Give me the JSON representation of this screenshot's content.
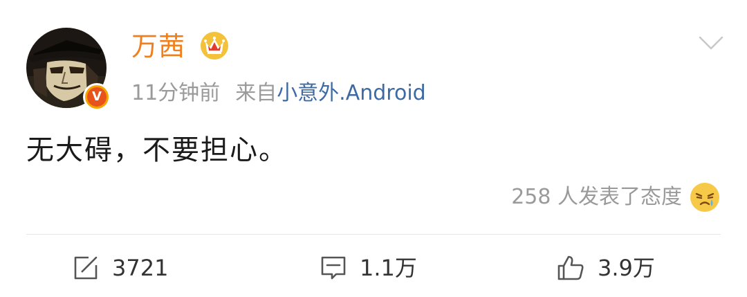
{
  "post": {
    "username": "万茜",
    "time": "11分钟前",
    "source_prefix": "来自",
    "source_name": "小意外.Android",
    "verified_badge": "V",
    "content": "无大碍，不要担心。",
    "reactions_text": "258 人发表了态度"
  },
  "actions": {
    "repost_count": "3721",
    "comment_count": "1.1万",
    "like_count": "3.9万"
  },
  "icons": {
    "avatar": "avatar-image",
    "crown": "crown-icon",
    "more": "chevron-down-icon",
    "reaction": "crying-face-icon",
    "repost": "share-icon",
    "comment": "comment-icon",
    "like": "thumbs-up-icon"
  },
  "colors": {
    "username": "#f07f1d",
    "source_link": "#3d6aa3",
    "meta_text": "#9a9a9a",
    "badge_orange": "#e8531c",
    "badge_ring": "#f6a400",
    "crown_gold": "#f3c13a",
    "crown_red": "#e23c2c"
  }
}
